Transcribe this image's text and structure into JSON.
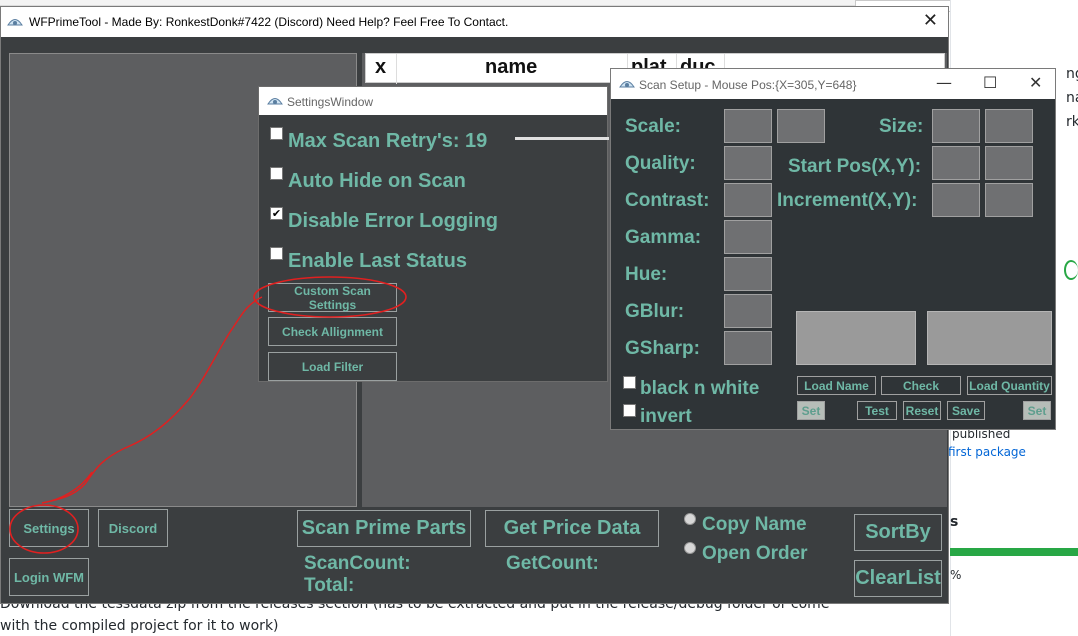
{
  "background": {
    "right_text_1": "published",
    "right_link": "first package",
    "right_text_2": "s",
    "right_text_3": "%",
    "bottom_text_1": "Download the tessdata zip from the releases section (has to be extracted and put in the release/debug folder or come",
    "bottom_text_2": "with the compiled project for it to work)",
    "edge_texts": [
      "ng",
      "na",
      "rk"
    ]
  },
  "main_window": {
    "title": "WFPrimeTool - Made By: RonkestDonk#7422 (Discord) Need Help? Feel Free To Contact.",
    "close_glyph": "✕",
    "grid_headers": [
      "x",
      "name",
      "plat",
      "duc"
    ],
    "buttons": {
      "settings": "Settings",
      "discord": "Discord",
      "login": "Login WFM",
      "scan": "Scan Prime Parts",
      "price": "Get Price Data",
      "sortby": "SortBy",
      "clearlist": "ClearList"
    },
    "radios": [
      "Copy Name",
      "Open Order"
    ],
    "labels": {
      "scan_count": "ScanCount:",
      "total": "Total:",
      "get_count": "GetCount:"
    }
  },
  "settings_window": {
    "title": "SettingsWindow",
    "options": [
      {
        "label": "Max Scan Retry's: 19",
        "checked": false
      },
      {
        "label": "Auto Hide on Scan",
        "checked": false
      },
      {
        "label": "Disable Error Logging",
        "checked": true
      },
      {
        "label": "Enable Last Status",
        "checked": false
      }
    ],
    "buttons": [
      "Custom Scan Settings",
      "Check Allignment",
      "Load Filter"
    ]
  },
  "scan_window": {
    "title": "Scan Setup - Mouse Pos:{X=305,Y=648}",
    "controls": [
      "—",
      "☐",
      "✕"
    ],
    "left_labels": [
      "Scale:",
      "Quality:",
      "Contrast:",
      "Gamma:",
      "Hue:",
      "GBlur:",
      "GSharp:"
    ],
    "right_labels": [
      "Size:",
      "Start Pos(X,Y):",
      "Increment(X,Y):"
    ],
    "checkboxes": [
      "black n white",
      "invert"
    ],
    "buttons_row1": [
      "Load Name",
      "Check",
      "Load Quantity"
    ],
    "buttons_row2": [
      "Set",
      "Test",
      "Reset",
      "Save",
      "Set"
    ]
  },
  "colors": {
    "accent_text": "#6fb8a6",
    "window_bg": "#3b3e40",
    "annotation": "#e02020"
  }
}
